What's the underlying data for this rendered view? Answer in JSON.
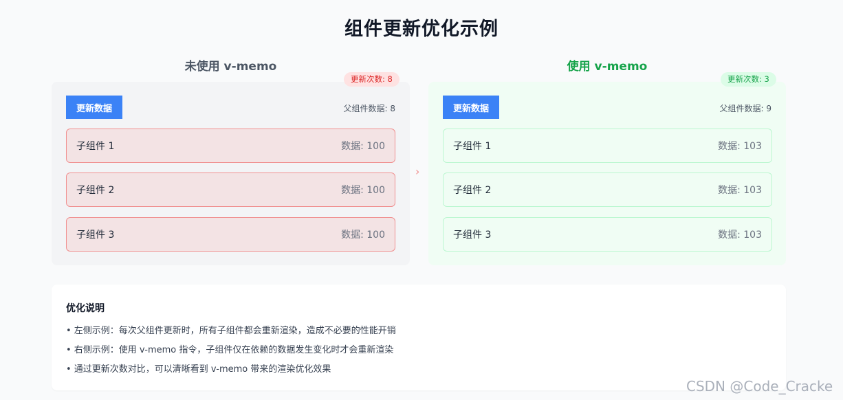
{
  "title": "组件更新优化示例",
  "left": {
    "heading": "未使用 v-memo",
    "badge": "更新次数: 8",
    "button": "更新数据",
    "parent_data": "父组件数据: 8",
    "children": [
      {
        "name": "子组件 1",
        "data": "数据: 100"
      },
      {
        "name": "子组件 2",
        "data": "数据: 100"
      },
      {
        "name": "子组件 3",
        "data": "数据: 100"
      }
    ]
  },
  "right": {
    "heading": "使用 v-memo",
    "badge": "更新次数: 3",
    "button": "更新数据",
    "parent_data": "父组件数据: 9",
    "children": [
      {
        "name": "子组件 1",
        "data": "数据: 103"
      },
      {
        "name": "子组件 2",
        "data": "数据: 103"
      },
      {
        "name": "子组件 3",
        "data": "数据: 103"
      }
    ]
  },
  "arrow": "›",
  "notes": {
    "title": "优化说明",
    "items": [
      "• 左侧示例：每次父组件更新时，所有子组件都会重新渲染，造成不必要的性能开销",
      "• 右侧示例：使用 v-memo 指令，子组件仅在依赖的数据发生变化时才会重新渲染",
      "• 通过更新次数对比，可以清晰看到 v-memo 带来的渲染优化效果"
    ]
  },
  "watermark": "CSDN @Code_Cracke",
  "colors": {
    "primary": "#3b82f6",
    "danger": "#dc2626",
    "success": "#16a34a"
  }
}
